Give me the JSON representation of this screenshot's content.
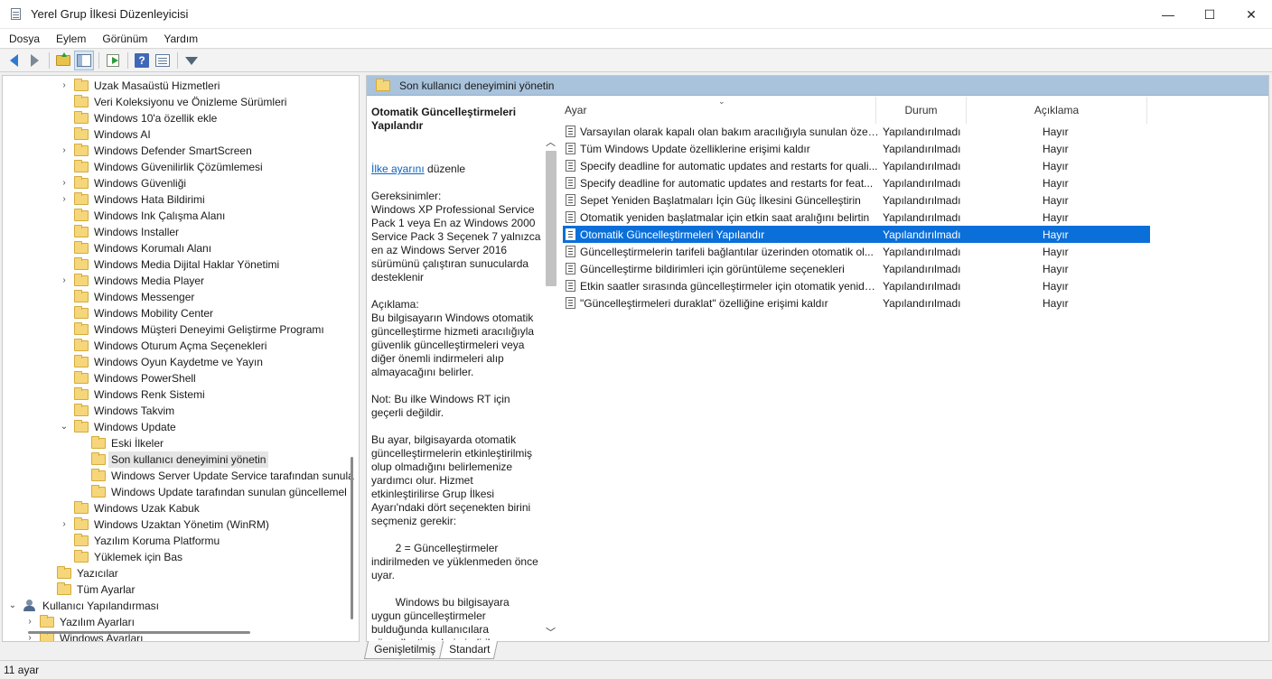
{
  "window": {
    "title": "Yerel Grup İlkesi Düzenleyicisi",
    "minimize": "—",
    "maximize": "☐",
    "close": "✕"
  },
  "menu": [
    "Dosya",
    "Eylem",
    "Görünüm",
    "Yardım"
  ],
  "toolbar": {
    "help_glyph": "?"
  },
  "tree": {
    "items": [
      {
        "label": "Uzak Masaüstü Hizmetleri",
        "expander": "›"
      },
      {
        "label": "Veri Koleksiyonu ve Önizleme Sürümleri",
        "expander": ""
      },
      {
        "label": "Windows 10'a özellik ekle",
        "expander": ""
      },
      {
        "label": "Windows AI",
        "expander": ""
      },
      {
        "label": "Windows Defender SmartScreen",
        "expander": "›"
      },
      {
        "label": "Windows Güvenilirlik Çözümlemesi",
        "expander": ""
      },
      {
        "label": "Windows Güvenliği",
        "expander": "›"
      },
      {
        "label": "Windows Hata Bildirimi",
        "expander": "›"
      },
      {
        "label": "Windows Ink Çalışma Alanı",
        "expander": ""
      },
      {
        "label": "Windows Installer",
        "expander": ""
      },
      {
        "label": "Windows Korumalı Alanı",
        "expander": ""
      },
      {
        "label": "Windows Media Dijital Haklar Yönetimi",
        "expander": ""
      },
      {
        "label": "Windows Media Player",
        "expander": "›"
      },
      {
        "label": "Windows Messenger",
        "expander": ""
      },
      {
        "label": "Windows Mobility Center",
        "expander": ""
      },
      {
        "label": "Windows Müşteri Deneyimi Geliştirme Programı",
        "expander": ""
      },
      {
        "label": "Windows Oturum Açma Seçenekleri",
        "expander": ""
      },
      {
        "label": "Windows Oyun Kaydetme ve Yayın",
        "expander": ""
      },
      {
        "label": "Windows PowerShell",
        "expander": ""
      },
      {
        "label": "Windows Renk Sistemi",
        "expander": ""
      },
      {
        "label": "Windows Takvim",
        "expander": ""
      },
      {
        "label": "Windows Update",
        "expander": "⌄"
      },
      {
        "label": "Eski İlkeler",
        "expander": ""
      },
      {
        "label": "Son kullanıcı deneyimini yönetin",
        "expander": ""
      },
      {
        "label": "Windows Server Update Service tarafından sunula",
        "expander": ""
      },
      {
        "label": "Windows Update tarafından sunulan güncellemel",
        "expander": ""
      },
      {
        "label": "Windows Uzak Kabuk",
        "expander": ""
      },
      {
        "label": "Windows Uzaktan Yönetim (WinRM)",
        "expander": "›"
      },
      {
        "label": "Yazılım Koruma Platformu",
        "expander": ""
      },
      {
        "label": "Yüklemek için Bas",
        "expander": ""
      },
      {
        "label": "Yazıcılar",
        "expander": ""
      },
      {
        "label": "Tüm Ayarlar",
        "expander": ""
      },
      {
        "label": "Kullanıcı Yapılandırması",
        "expander": "⌄"
      },
      {
        "label": "Yazılım Ayarları",
        "expander": "›"
      },
      {
        "label": "Windows Ayarları",
        "expander": "›"
      }
    ]
  },
  "content": {
    "header": "Son kullanıcı deneyimini yönetin",
    "description": {
      "title": "Otomatik Güncelleştirmeleri Yapılandır",
      "edit_link": "İlke ayarını",
      "edit_suffix": " düzenle",
      "requirements": "Gereksinimler:\nWindows XP Professional Service Pack 1 veya En az Windows 2000 Service Pack 3 Seçenek 7 yalnızca en az Windows Server 2016 sürümünü çalıştıran sunucularda desteklenir",
      "description_text": "Açıklama:\nBu bilgisayarın Windows otomatik güncelleştirme hizmeti aracılığıyla güvenlik güncelleştirmeleri veya diğer önemli indirmeleri alıp almayacağını belirler.",
      "note": "Not: Bu ilke Windows RT için geçerli değildir.",
      "para1": "Bu ayar, bilgisayarda otomatik güncelleştirmelerin etkinleştirilmiş olup olmadığını belirlemenize yardımcı olur. Hizmet etkinleştirilirse Grup İlkesi Ayarı'ndaki dört seçenekten birini seçmeniz gerekir:",
      "para2": "        2 = Güncelleştirmeler indirilmeden ve yüklenmeden önce uyar.",
      "para3": "        Windows bu bilgisayara uygun güncelleştirmeler bulduğunda kullanıcılara güncelleştirmelerin indirilmeye hazır olduğu bildirilir. Kullanıcılar"
    },
    "columns": {
      "setting": "Ayar",
      "status": "Durum",
      "comment": "Açıklama"
    },
    "rows": [
      {
        "name": "Varsayılan olarak kapalı olan bakım aracılığıyla sunulan özelli...",
        "status": "Yapılandırılmadı",
        "comment": "Hayır"
      },
      {
        "name": "Tüm Windows Update özelliklerine erişimi kaldır",
        "status": "Yapılandırılmadı",
        "comment": "Hayır"
      },
      {
        "name": "Specify deadline for automatic updates and restarts for quali...",
        "status": "Yapılandırılmadı",
        "comment": "Hayır"
      },
      {
        "name": "Specify deadline for automatic updates and restarts for feat...",
        "status": "Yapılandırılmadı",
        "comment": "Hayır"
      },
      {
        "name": "Sepet Yeniden Başlatmaları İçin Güç İlkesini Güncelleştirin",
        "status": "Yapılandırılmadı",
        "comment": "Hayır"
      },
      {
        "name": "Otomatik yeniden başlatmalar için etkin saat aralığını belirtin",
        "status": "Yapılandırılmadı",
        "comment": "Hayır"
      },
      {
        "name": "Otomatik Güncelleştirmeleri Yapılandır",
        "status": "Yapılandırılmadı",
        "comment": "Hayır"
      },
      {
        "name": "Güncelleştirmelerin tarifeli bağlantılar üzerinden otomatik ol...",
        "status": "Yapılandırılmadı",
        "comment": "Hayır"
      },
      {
        "name": "Güncelleştirme bildirimleri için görüntüleme seçenekleri",
        "status": "Yapılandırılmadı",
        "comment": "Hayır"
      },
      {
        "name": "Etkin saatler sırasında güncelleştirmeler için otomatik yenide...",
        "status": "Yapılandırılmadı",
        "comment": "Hayır"
      },
      {
        "name": "\"Güncelleştirmeleri duraklat\" özelliğine erişimi kaldır",
        "status": "Yapılandırılmadı",
        "comment": "Hayır"
      }
    ]
  },
  "tabs": [
    "Genişletilmiş",
    "Standart"
  ],
  "status": "11 ayar",
  "colors": {
    "selection": "#0a6fd9",
    "header_band": "#a9c3dc",
    "link": "#0b63c4"
  }
}
